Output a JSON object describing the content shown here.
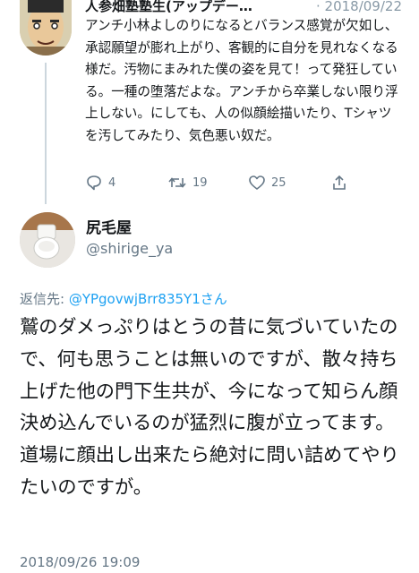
{
  "parent_tweet": {
    "author_name": "人参畑塾塾生(アップデー…",
    "date": "· 2018/09/22",
    "text": "アンチ小林よしのりになるとバランス感覚が欠如し、承認願望が膨れ上がり、客観的に自分を見れなくなる様だ。汚物にまみれた僕の姿を見て！って発狂している。一種の堕落だよな。アンチから卒業しない限り浮上しない。にしても、人の似顔絵描いたり、Tシャツを汚してみたり、気色悪い奴だ。",
    "reply_count": "4",
    "retweet_count": "19",
    "like_count": "25",
    "icons": {
      "reply": "speech-bubble-icon",
      "retweet": "retweet-icon",
      "like": "heart-icon",
      "share": "share-icon"
    }
  },
  "main_tweet": {
    "author_name": "尻毛屋",
    "handle": "@shirige_ya",
    "reply_prefix": "返信先: ",
    "reply_mention": "@YPgovwjBrr835Y1さん",
    "text": "鷲のダメっぷりはとうの昔に気づいていたので、何も思うことは無いのですが、散々持ち上げた他の門下生共が、今になって知らん顔決め込んでいるのが猛烈に腹が立ってます。道場に顔出し出来たら絶対に問い詰めてやりたいのですが。",
    "timestamp": "2018/09/26 19:09"
  },
  "colors": {
    "text": "#14171a",
    "secondary": "#657786",
    "link": "#1da1f2",
    "thread_line": "#ccd6dd"
  }
}
